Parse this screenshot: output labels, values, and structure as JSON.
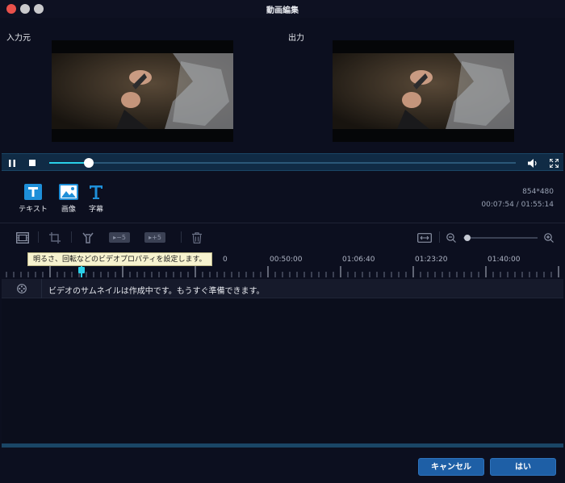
{
  "window": {
    "title": "動画編集"
  },
  "panes": {
    "input_label": "入力元",
    "output_label": "出力"
  },
  "player": {
    "progress": 0.085,
    "volume_icon": "speaker-icon",
    "fullscreen_icon": "fullscreen-icon"
  },
  "tools": [
    {
      "label": "テキスト",
      "icon": "text-icon"
    },
    {
      "label": "画像",
      "icon": "image-icon"
    },
    {
      "label": "字幕",
      "icon": "subtitle-icon"
    }
  ],
  "video_info": {
    "resolution": "854*480",
    "time": "00:07:54 / 01:55:14"
  },
  "timeline_toolbar": {
    "minus5_label": "−5",
    "plus5_label": "+5",
    "zoom_level": 0.05
  },
  "ruler": {
    "labels": [
      "0",
      "00:50:00",
      "01:06:40",
      "01:23:20",
      "01:40:00"
    ]
  },
  "tooltip": "明るさ、回転などのビデオプロパティを設定します。",
  "track": {
    "message": "ビデオのサムネイルは作成中です。もうすぐ準備できます。"
  },
  "footer": {
    "cancel_label": "キャンセル",
    "ok_label": "はい"
  },
  "colors": {
    "accent": "#2ad0e8",
    "button": "#1e5fa6",
    "close": "#e9514b",
    "tooltip_bg": "#f7f3cf"
  }
}
